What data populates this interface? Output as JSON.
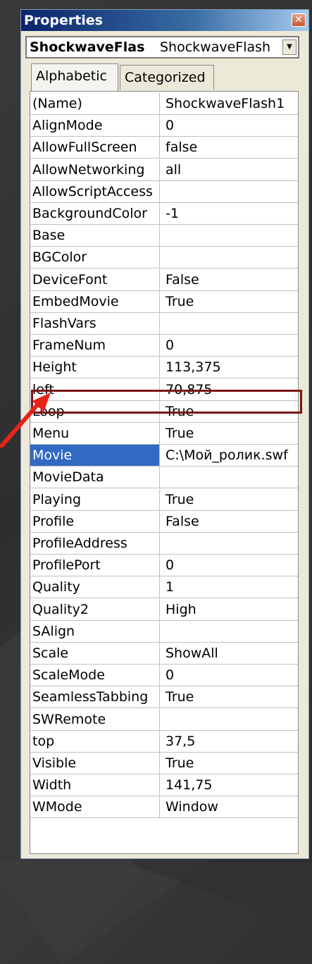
{
  "window": {
    "title": "Properties",
    "close_glyph": "✕"
  },
  "object_selector": {
    "name": "ShockwaveFlas",
    "type": "ShockwaveFlash",
    "dropdown_glyph": "▼"
  },
  "tabs": [
    {
      "label": "Alphabetic",
      "active": true
    },
    {
      "label": "Categorized",
      "active": false
    }
  ],
  "properties": [
    {
      "name": "(Name)",
      "value": "ShockwaveFlash1"
    },
    {
      "name": "AlignMode",
      "value": "0"
    },
    {
      "name": "AllowFullScreen",
      "value": "false"
    },
    {
      "name": "AllowNetworking",
      "value": "all"
    },
    {
      "name": "AllowScriptAccess",
      "value": ""
    },
    {
      "name": "BackgroundColor",
      "value": "-1"
    },
    {
      "name": "Base",
      "value": ""
    },
    {
      "name": "BGColor",
      "value": ""
    },
    {
      "name": "DeviceFont",
      "value": "False"
    },
    {
      "name": "EmbedMovie",
      "value": "True"
    },
    {
      "name": "FlashVars",
      "value": ""
    },
    {
      "name": "FrameNum",
      "value": "0"
    },
    {
      "name": "Height",
      "value": "113,375"
    },
    {
      "name": "left",
      "value": "70,875"
    },
    {
      "name": "Loop",
      "value": "True"
    },
    {
      "name": "Menu",
      "value": "True"
    },
    {
      "name": "Movie",
      "value": "C:\\Мой_ролик.swf",
      "selected": true
    },
    {
      "name": "MovieData",
      "value": ""
    },
    {
      "name": "Playing",
      "value": "True"
    },
    {
      "name": "Profile",
      "value": "False"
    },
    {
      "name": "ProfileAddress",
      "value": ""
    },
    {
      "name": "ProfilePort",
      "value": "0"
    },
    {
      "name": "Quality",
      "value": "1"
    },
    {
      "name": "Quality2",
      "value": "High"
    },
    {
      "name": "SAlign",
      "value": ""
    },
    {
      "name": "Scale",
      "value": "ShowAll"
    },
    {
      "name": "ScaleMode",
      "value": "0"
    },
    {
      "name": "SeamlessTabbing",
      "value": "True"
    },
    {
      "name": "SWRemote",
      "value": ""
    },
    {
      "name": "top",
      "value": "37,5"
    },
    {
      "name": "Visible",
      "value": "True"
    },
    {
      "name": "Width",
      "value": "141,75"
    },
    {
      "name": "WMode",
      "value": "Window"
    }
  ],
  "colors": {
    "selection": "#316ac5",
    "highlight_border": "#7b1515",
    "arrow": "#e8231a"
  }
}
